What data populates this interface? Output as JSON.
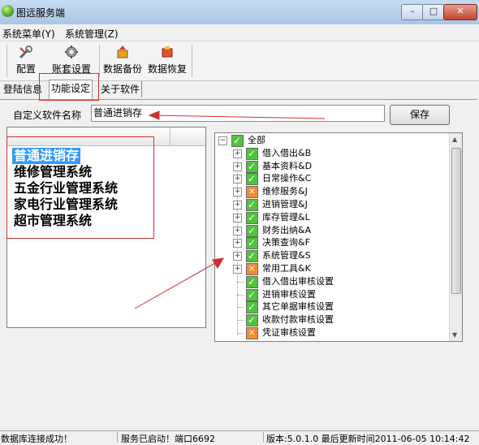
{
  "window": {
    "title": "图远服务端",
    "controls": {
      "minimize": "–",
      "maximize": "□",
      "close": "✕"
    }
  },
  "menu": [
    "系统菜单(Y)",
    "系统管理(Z)"
  ],
  "toolbar": [
    {
      "label": "配置",
      "icon": "wrench-icon"
    },
    {
      "label": "账套设置",
      "icon": "gear-icon"
    },
    {
      "label": "数据备份",
      "icon": "backup-icon"
    },
    {
      "label": "数据恢复",
      "icon": "restore-icon"
    }
  ],
  "tabs": [
    {
      "label": "登陆信息",
      "active": false
    },
    {
      "label": "功能设定",
      "active": true
    },
    {
      "label": "关于软件",
      "active": false
    }
  ],
  "settings": {
    "name_label": "自定义软件名称",
    "name_value": "普通进销存",
    "save_label": "保存"
  },
  "software_list": [
    "普通进销存",
    "维修管理系统",
    "五金行业管理系统",
    "家电行业管理系统",
    "超市管理系统"
  ],
  "selected_software": "普通进销存",
  "tree": {
    "root": {
      "label": "全部",
      "state": "checked"
    },
    "modules": [
      {
        "label": "借入借出&B",
        "state": "checked",
        "expandable": true
      },
      {
        "label": "基本资料&D",
        "state": "checked",
        "expandable": true
      },
      {
        "label": "日常操作&C",
        "state": "checked",
        "expandable": true
      },
      {
        "label": "维修服务&J",
        "state": "partial",
        "expandable": true
      },
      {
        "label": "进销管理&J",
        "state": "checked",
        "expandable": true
      },
      {
        "label": "库存管理&L",
        "state": "checked",
        "expandable": true
      },
      {
        "label": "财务出纳&A",
        "state": "checked",
        "expandable": true
      },
      {
        "label": "决策查询&F",
        "state": "checked",
        "expandable": true
      },
      {
        "label": "系统管理&S",
        "state": "checked",
        "expandable": true
      },
      {
        "label": "常用工具&K",
        "state": "partial",
        "expandable": true
      },
      {
        "label": "借入借出审核设置",
        "state": "checked",
        "expandable": false
      },
      {
        "label": "进销审核设置",
        "state": "checked",
        "expandable": false
      },
      {
        "label": "其它单据审核设置",
        "state": "checked",
        "expandable": false
      },
      {
        "label": "收款付款审核设置",
        "state": "checked",
        "expandable": false
      },
      {
        "label": "凭证审核设置",
        "state": "partial",
        "expandable": false
      }
    ]
  },
  "status": {
    "db": "数据库连接成功！",
    "service": "服务已启动！端口6692",
    "version": "版本:5.0.1.0 最后更新时间2011-06-05 10:14:42"
  },
  "colors": {
    "checked": "#4fc33c",
    "partial": "#f08c30",
    "annotation": "#d03030",
    "selection": "#3399ff"
  }
}
